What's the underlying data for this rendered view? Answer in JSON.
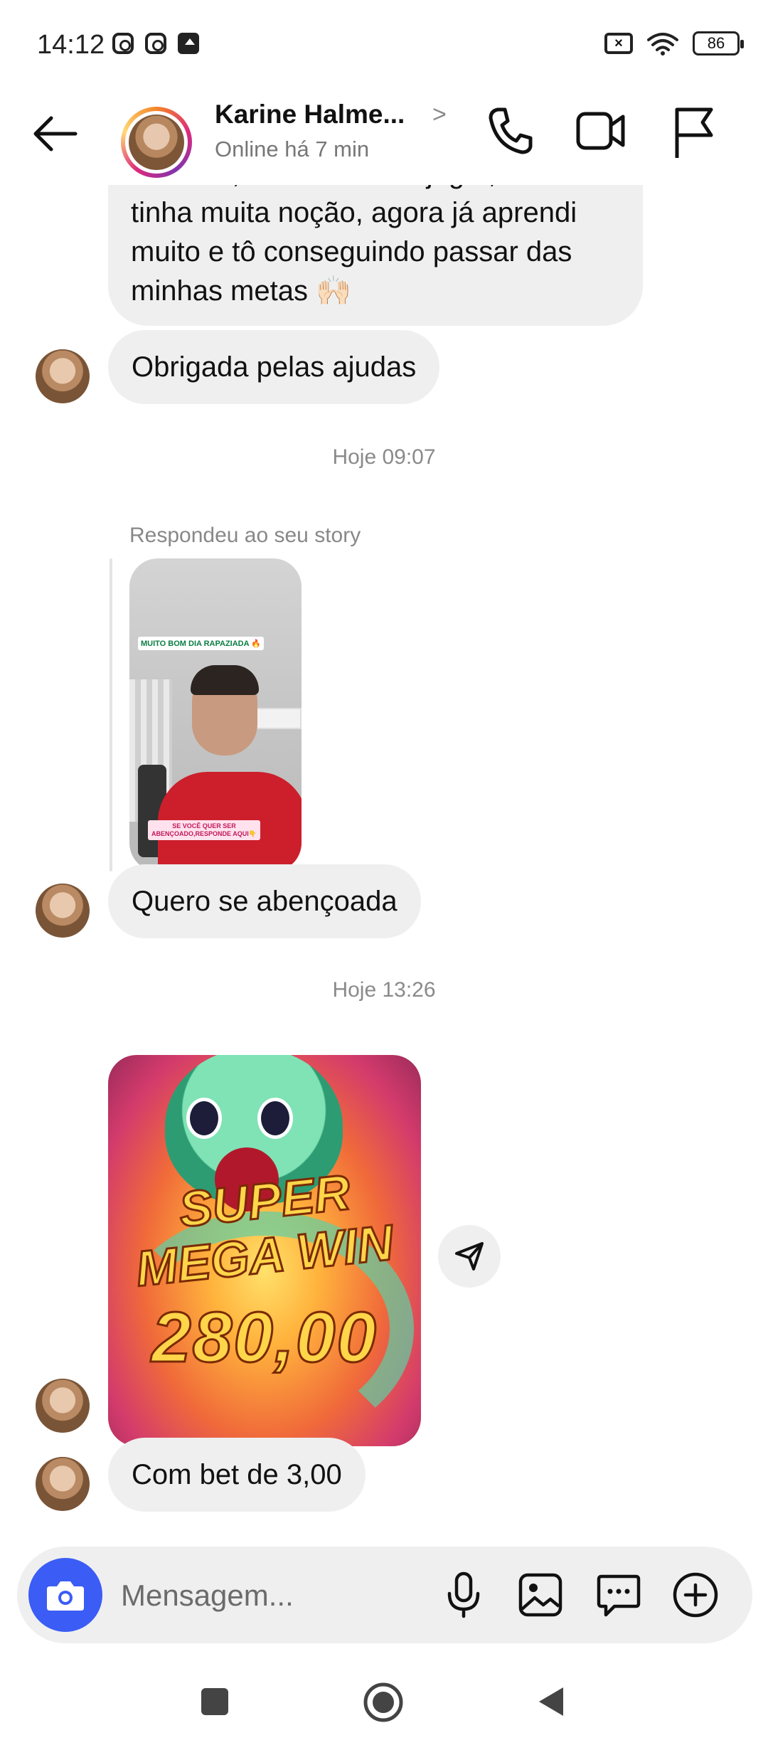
{
  "status_bar": {
    "time": "14:12",
    "battery": "86",
    "notification_icons": [
      "instagram-icon",
      "instagram-icon",
      "upload-icon"
    ]
  },
  "header": {
    "name": "Karine Halme...",
    "status": "Online há 7 min"
  },
  "messages": {
    "partial_text": "chamou, eu nem sabia jogar, não tinha muita noção, agora já aprendi muito e tô conseguindo passar das minhas metas 🙌🏻",
    "partial_line1": "chamou, eu nem sabia jogar, não",
    "partial_line2": "tinha muita noção, agora já aprendi",
    "partial_line3": "muito e tô conseguindo passar das",
    "partial_line4": "minhas metas 🙌🏻",
    "msg1": "Obrigada pelas ajudas",
    "time1": "Hoje 09:07",
    "story_reply_label": "Respondeu ao seu story",
    "story_caption_top": "MUITO BOM DIA RAPAZIADA 🔥",
    "story_caption_bottom": "SE VOCÊ QUER SER ABENÇOADO,RESPONDE AQUI👇",
    "msg2": "Quero se abençoada",
    "time2": "Hoje 13:26",
    "promo_line1": "SUPER",
    "promo_line2": "MEGA WIN",
    "promo_amount": "280,00",
    "msg3": "Com bet de 3,00"
  },
  "composer": {
    "placeholder": "Mensagem..."
  },
  "colors": {
    "accent_blue": "#3b5cf5",
    "bubble_gray": "#efefef",
    "muted_text": "#8a8a8a"
  }
}
